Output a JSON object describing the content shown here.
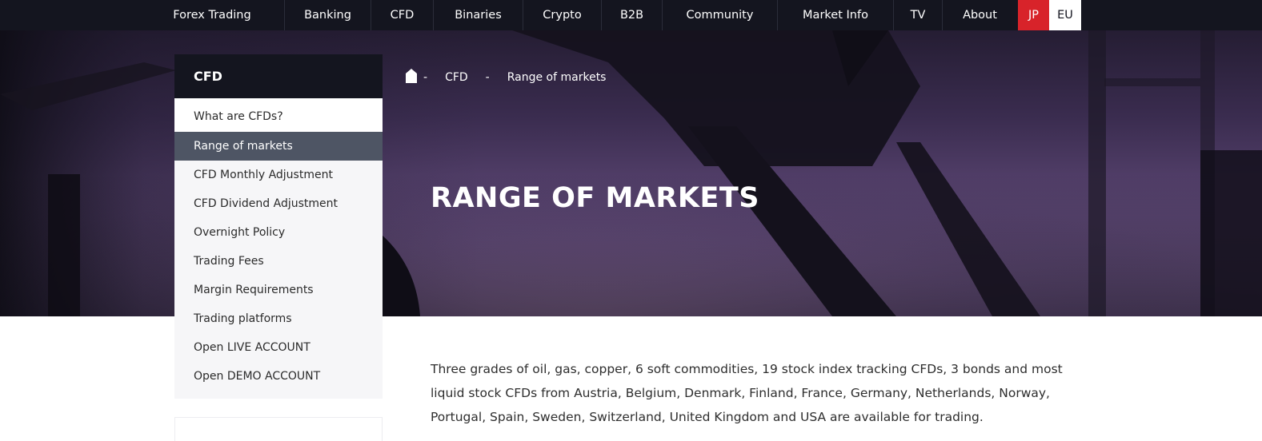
{
  "nav": {
    "items": [
      {
        "label": "Forex Trading"
      },
      {
        "label": "Banking"
      },
      {
        "label": "CFD"
      },
      {
        "label": "Binaries"
      },
      {
        "label": "Crypto"
      },
      {
        "label": "B2B"
      },
      {
        "label": "Community"
      },
      {
        "label": "Market Info"
      },
      {
        "label": "TV"
      },
      {
        "label": "About"
      }
    ],
    "lang_jp": "JP",
    "lang_eu": "EU"
  },
  "breadcrumb": {
    "home_icon": "home-icon",
    "separator": "-",
    "items": [
      "CFD",
      "Range of markets"
    ]
  },
  "hero": {
    "title": "RANGE OF MARKETS"
  },
  "sidebar": {
    "heading": "CFD",
    "links": [
      "What are CFDs?",
      "Range of markets",
      "CFD Monthly Adjustment",
      "CFD Dividend Adjustment",
      "Overnight Policy",
      "Trading Fees",
      "Margin Requirements",
      "Trading platforms",
      "Open LIVE ACCOUNT",
      "Open DEMO ACCOUNT"
    ],
    "active_index": 1
  },
  "content": {
    "intro": "Three grades of oil, gas, copper, 6 soft commodities, 19 stock index tracking CFDs, 3 bonds and most liquid stock CFDs from Austria, Belgium, Denmark, Finland, France, Germany, Netherlands, Norway, Portugal, Spain, Sweden, Switzerland, United Kingdom and USA are available for trading."
  },
  "colors": {
    "nav_bg": "#14151f",
    "lang_jp_bg": "#d8232a",
    "sidebar_active_bg": "#4e5564",
    "hero_tint": "#5e4876"
  }
}
